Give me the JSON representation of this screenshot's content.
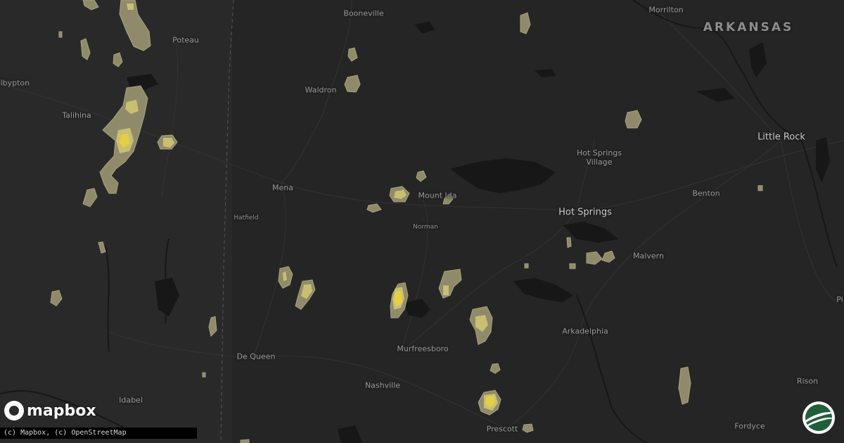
{
  "map": {
    "state_label": "ARKANSAS",
    "cities": {
      "little_rock": "Little Rock",
      "hot_springs": "Hot Springs",
      "hot_springs_village": "Hot Springs\nVillage",
      "benton": "Benton",
      "malvern": "Malvern",
      "arkadelphia": "Arkadelphia",
      "murfreesboro": "Murfreesboro",
      "nashville": "Nashville",
      "prescott": "Prescott",
      "de_queen": "De Queen",
      "idabel": "Idabel",
      "mena": "Mena",
      "hatfield": "Hatfield",
      "norman": "Norman",
      "mount_ida": "Mount Ida",
      "waldron": "Waldron",
      "booneville": "Booneville",
      "poteau": "Poteau",
      "talihina": "Talihina",
      "wilburton": "albурton",
      "morrilton": "Morrilton",
      "rison": "Rison",
      "fordyce": "Fordyce",
      "pine_bluff_partial": "Pi"
    },
    "colors": {
      "background": "#252525",
      "water": "#171717",
      "roads": "#333333",
      "hail_outer": "#8f8b6a",
      "hail_mid": "#c9bf73",
      "hail_core": "#e6cf43"
    }
  },
  "attribution": "(c) Mapbox, (c) OpenStreetMap",
  "logo": {
    "text": "mapbox",
    "icon": "mapbox-logo-icon"
  },
  "brand": {
    "icon": "brand-badge-icon"
  }
}
